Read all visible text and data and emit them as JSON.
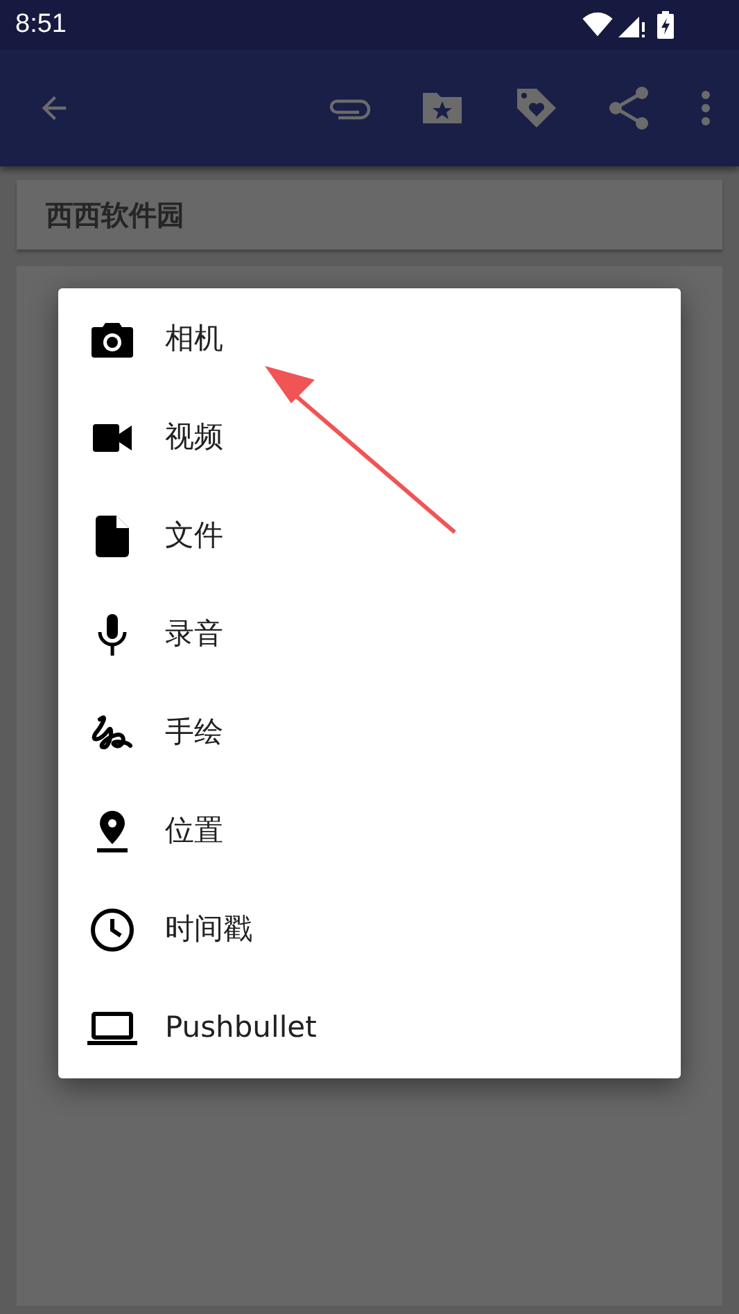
{
  "status_bar": {
    "time": "8:51"
  },
  "toolbar": {
    "actions": [
      {
        "kind": "attach"
      },
      {
        "kind": "folder-star"
      },
      {
        "kind": "tag-heart"
      },
      {
        "kind": "share"
      },
      {
        "kind": "more"
      }
    ]
  },
  "note": {
    "title": "西西软件园"
  },
  "menu": {
    "items": [
      {
        "kind": "camera",
        "label": "相机"
      },
      {
        "kind": "video",
        "label": "视频"
      },
      {
        "kind": "file",
        "label": "文件"
      },
      {
        "kind": "mic",
        "label": "录音"
      },
      {
        "kind": "scribble",
        "label": "手绘"
      },
      {
        "kind": "place",
        "label": "位置"
      },
      {
        "kind": "clock",
        "label": "时间戳"
      },
      {
        "kind": "laptop",
        "label": "Pushbullet"
      }
    ]
  }
}
